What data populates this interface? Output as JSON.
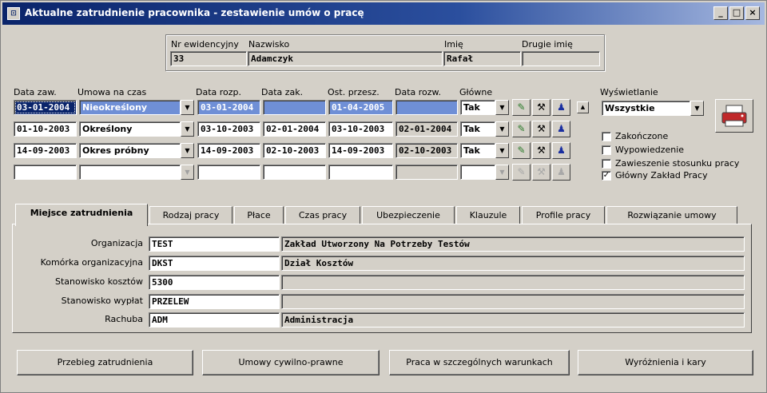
{
  "window": {
    "title": "Aktualne zatrudnienie pracownika - zestawienie umów o pracę",
    "icon_glyph": "⊡",
    "minimize": "_",
    "maximize": "□",
    "close": "×"
  },
  "employee": {
    "nr_label": "Nr ewidencyjny",
    "nr_value": "33",
    "surname_label": "Nazwisko",
    "surname_value": "Adamczyk",
    "firstname_label": "Imię",
    "firstname_value": "Rafał",
    "secondname_label": "Drugie imię",
    "secondname_value": ""
  },
  "contracts": {
    "headers": {
      "data_zaw": "Data zaw.",
      "umowa": "Umowa na czas",
      "data_rozp": "Data rozp.",
      "data_zak": "Data zak.",
      "ost_przesz": "Ost. przesz.",
      "data_rozw": "Data rozw.",
      "glowne": "Główne"
    },
    "rows": [
      {
        "data_zaw": "03-01-2004",
        "umowa": "Nieokreślony",
        "data_rozp": "03-01-2004",
        "data_zak": "",
        "ost_przesz": "01-04-2005",
        "data_rozw": "",
        "glowne": "Tak"
      },
      {
        "data_zaw": "01-10-2003",
        "umowa": "Określony",
        "data_rozp": "03-10-2003",
        "data_zak": "02-01-2004",
        "ost_przesz": "03-10-2003",
        "data_rozw": "02-01-2004",
        "glowne": "Tak"
      },
      {
        "data_zaw": "14-09-2003",
        "umowa": "Okres próbny",
        "data_rozp": "14-09-2003",
        "data_zak": "02-10-2003",
        "ost_przesz": "14-09-2003",
        "data_rozw": "02-10-2003",
        "glowne": "Tak"
      },
      {
        "data_zaw": "",
        "umowa": "",
        "data_rozp": "",
        "data_zak": "",
        "ost_przesz": "",
        "data_rozw": "",
        "glowne": ""
      }
    ],
    "icons": {
      "edit": "✎",
      "tool": "⚒",
      "person": "♟",
      "scroll_up": "▲",
      "dropdown": "▼"
    }
  },
  "display": {
    "label": "Wyświetlanie",
    "value": "Wszystkie",
    "options": [
      {
        "label": "Zakończone",
        "checked": false
      },
      {
        "label": "Wypowiedzenie",
        "checked": false
      },
      {
        "label": "Zawieszenie stosunku pracy",
        "checked": false
      },
      {
        "label": "Główny Zakład Pracy",
        "checked": true
      }
    ],
    "check_mark": "✓",
    "print_icon": "⎙"
  },
  "tabs": [
    "Miejsce zatrudnienia",
    "Rodzaj pracy",
    "Płace",
    "Czas pracy",
    "Ubezpieczenie",
    "Klauzule",
    "Profile pracy",
    "Rozwiązanie umowy"
  ],
  "workplace": [
    {
      "label": "Organizacja",
      "code": "TEST",
      "name": "Zakład Utworzony Na Potrzeby Testów"
    },
    {
      "label": "Komórka organizacyjna",
      "code": "DKST",
      "name": "Dział Kosztów"
    },
    {
      "label": "Stanowisko kosztów",
      "code": "5300",
      "name": ""
    },
    {
      "label": "Stanowisko wypłat",
      "code": "PRZELEW",
      "name": ""
    },
    {
      "label": "Rachuba",
      "code": "ADM",
      "name": "Administracja"
    }
  ],
  "buttons": {
    "przebieg": "Przebieg zatrudnienia",
    "umowy": "Umowy cywilno-prawne",
    "praca": "Praca w szczególnych warunkach",
    "wyroznienia": "Wyróżnienia i kary"
  },
  "colors": {
    "titlebar": "#0a246a",
    "selection": "#6f8fd6",
    "face": "#d4d0c8"
  }
}
